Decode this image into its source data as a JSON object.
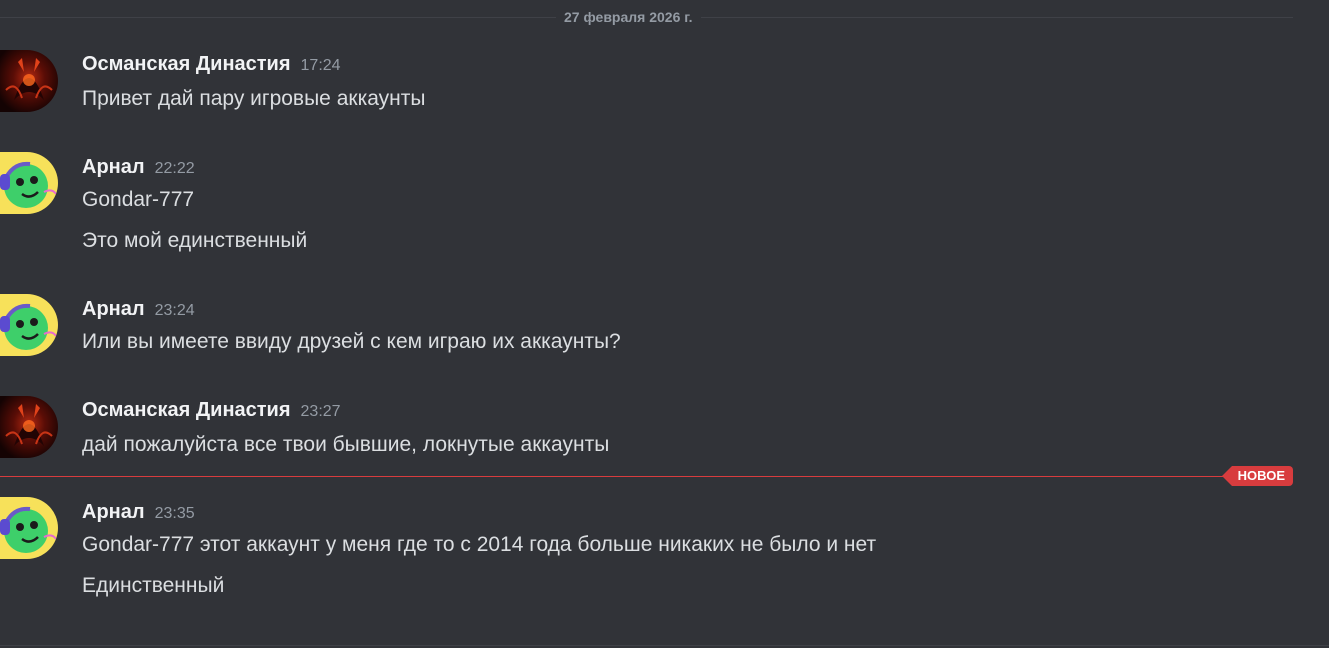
{
  "date_divider": "27 февраля 2026 г.",
  "new_badge": "НОВОЕ",
  "messages": [
    {
      "author": "Османская Династия",
      "time": "17:24",
      "avatar": "dark-red-avatar",
      "lines": [
        "Привет дай пару игровые аккаунты"
      ]
    },
    {
      "author": "Арнал",
      "time": "22:22",
      "avatar": "green-creature-avatar",
      "lines": [
        "Gondar-777",
        "Это мой единственный"
      ]
    },
    {
      "author": "Арнал",
      "time": "23:24",
      "avatar": "green-creature-avatar",
      "lines": [
        "Или вы имеете ввиду друзей с кем играю их аккаунты?"
      ]
    },
    {
      "author": "Османская Династия",
      "time": "23:27",
      "avatar": "dark-red-avatar",
      "lines": [
        "дай пожалуйста все твои бывшие, локнутые аккаунты"
      ]
    },
    {
      "author": "Арнал",
      "time": "23:35",
      "avatar": "green-creature-avatar",
      "lines": [
        "Gondar-777 этот аккаунт у меня где то с 2014 года больше никаких не было и нет",
        "Единственный"
      ]
    }
  ],
  "colors": {
    "background": "#313338",
    "accent_new": "#d83c3e"
  }
}
